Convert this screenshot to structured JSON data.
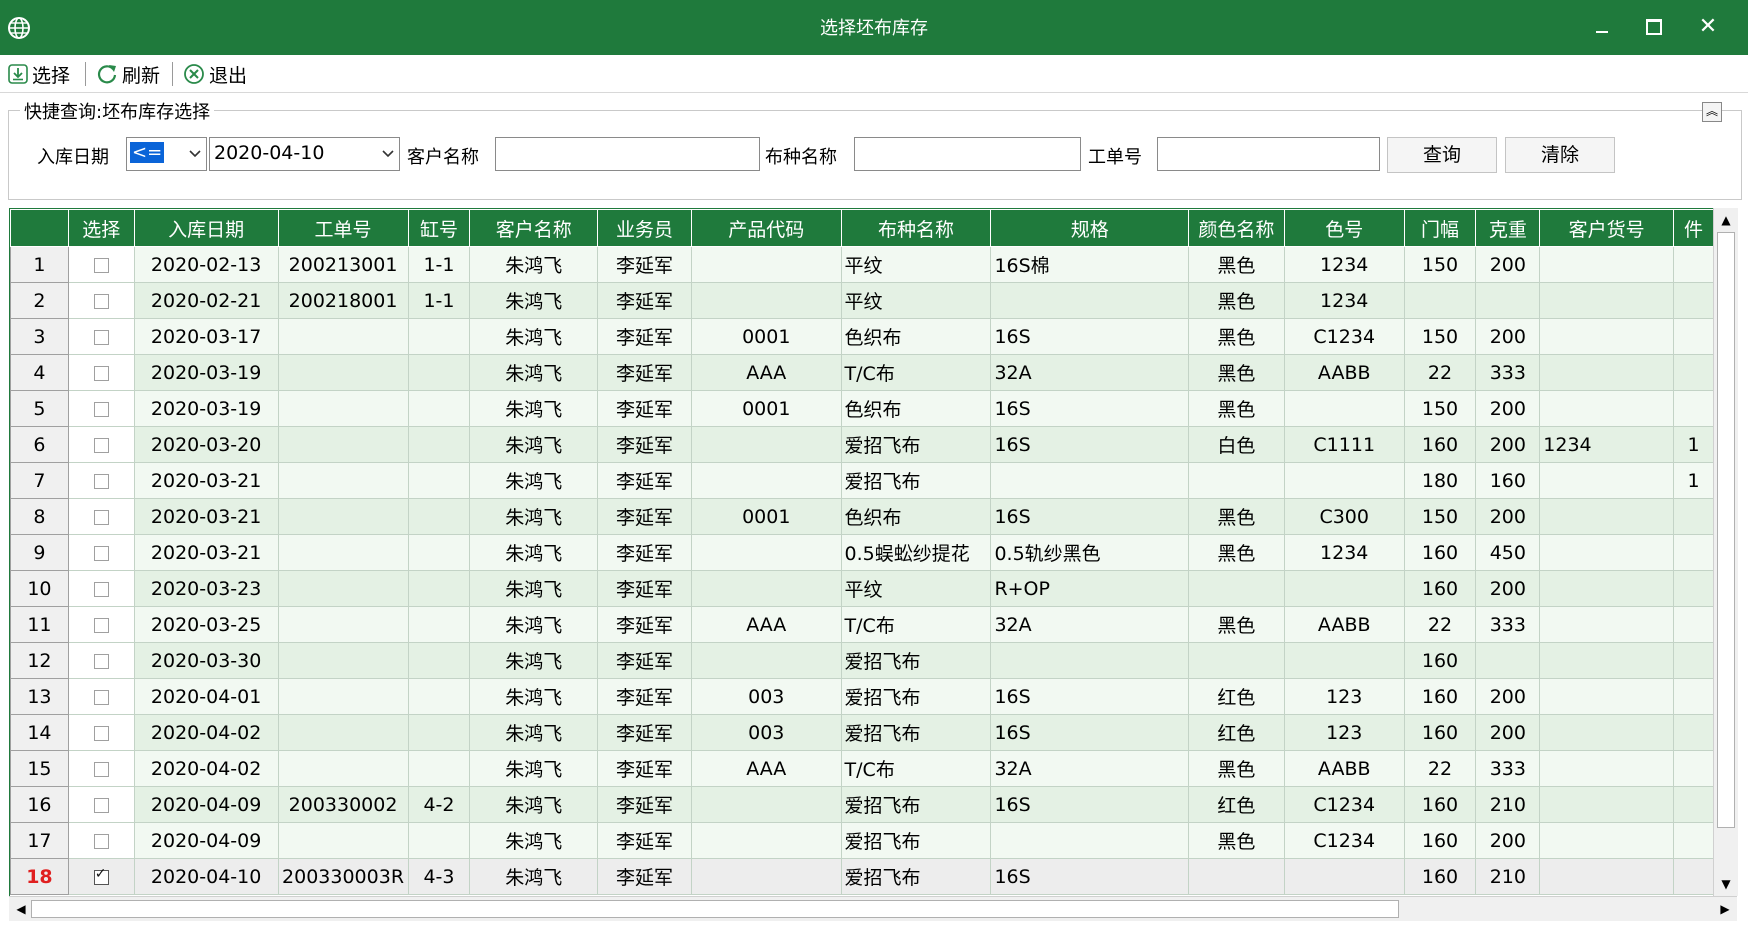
{
  "window": {
    "title": "选择坯布库存"
  },
  "toolbar": {
    "select_label": "选择",
    "refresh_label": "刷新",
    "exit_label": "退出"
  },
  "query": {
    "group_title": "快捷查询:坯布库存选择",
    "date_label": "入库日期",
    "operator_value": "<=",
    "date_value": "2020-04-10",
    "customer_label": "客户名称",
    "customer_value": "",
    "fabric_label": "布种名称",
    "fabric_value": "",
    "order_label": "工单号",
    "order_value": "",
    "search_button": "查询",
    "clear_button": "清除"
  },
  "grid": {
    "columns": [
      "",
      "选择",
      "入库日期",
      "工单号",
      "缸号",
      "客户名称",
      "业务员",
      "产品代码",
      "布种名称",
      "规格",
      "颜色名称",
      "色号",
      "门幅",
      "克重",
      "客户货号",
      "件"
    ],
    "current_row": 18,
    "rows": [
      {
        "n": "1",
        "checked": false,
        "date": "2020-02-13",
        "order": "200213001",
        "vat": "1-1",
        "customer": "朱鸿飞",
        "sales": "李延军",
        "code": "",
        "fabric": "平纹",
        "spec": "16S棉",
        "color": "黑色",
        "colorno": "1234",
        "width": "150",
        "weight": "200",
        "custno": "",
        "pcs": ""
      },
      {
        "n": "2",
        "checked": false,
        "date": "2020-02-21",
        "order": "200218001",
        "vat": "1-1",
        "customer": "朱鸿飞",
        "sales": "李延军",
        "code": "",
        "fabric": "平纹",
        "spec": "",
        "color": "黑色",
        "colorno": "1234",
        "width": "",
        "weight": "",
        "custno": "",
        "pcs": ""
      },
      {
        "n": "3",
        "checked": false,
        "date": "2020-03-17",
        "order": "",
        "vat": "",
        "customer": "朱鸿飞",
        "sales": "李延军",
        "code": "0001",
        "fabric": "色织布",
        "spec": "16S",
        "color": "黑色",
        "colorno": "C1234",
        "width": "150",
        "weight": "200",
        "custno": "",
        "pcs": ""
      },
      {
        "n": "4",
        "checked": false,
        "date": "2020-03-19",
        "order": "",
        "vat": "",
        "customer": "朱鸿飞",
        "sales": "李延军",
        "code": "AAA",
        "fabric": "T/C布",
        "spec": "32A",
        "color": "黑色",
        "colorno": "AABB",
        "width": "22",
        "weight": "333",
        "custno": "",
        "pcs": ""
      },
      {
        "n": "5",
        "checked": false,
        "date": "2020-03-19",
        "order": "",
        "vat": "",
        "customer": "朱鸿飞",
        "sales": "李延军",
        "code": "0001",
        "fabric": "色织布",
        "spec": "16S",
        "color": "黑色",
        "colorno": "",
        "width": "150",
        "weight": "200",
        "custno": "",
        "pcs": ""
      },
      {
        "n": "6",
        "checked": false,
        "date": "2020-03-20",
        "order": "",
        "vat": "",
        "customer": "朱鸿飞",
        "sales": "李延军",
        "code": "",
        "fabric": "爱招飞布",
        "spec": "16S",
        "color": "白色",
        "colorno": "C1111",
        "width": "160",
        "weight": "200",
        "custno": "1234",
        "pcs": "1"
      },
      {
        "n": "7",
        "checked": false,
        "date": "2020-03-21",
        "order": "",
        "vat": "",
        "customer": "朱鸿飞",
        "sales": "李延军",
        "code": "",
        "fabric": "爱招飞布",
        "spec": "",
        "color": "",
        "colorno": "",
        "width": "180",
        "weight": "160",
        "custno": "",
        "pcs": "1"
      },
      {
        "n": "8",
        "checked": false,
        "date": "2020-03-21",
        "order": "",
        "vat": "",
        "customer": "朱鸿飞",
        "sales": "李延军",
        "code": "0001",
        "fabric": "色织布",
        "spec": "16S",
        "color": "黑色",
        "colorno": "C300",
        "width": "150",
        "weight": "200",
        "custno": "",
        "pcs": ""
      },
      {
        "n": "9",
        "checked": false,
        "date": "2020-03-21",
        "order": "",
        "vat": "",
        "customer": "朱鸿飞",
        "sales": "李延军",
        "code": "",
        "fabric": "0.5蜈蚣纱提花",
        "spec": "0.5轨纱黑色",
        "color": "黑色",
        "colorno": "1234",
        "width": "160",
        "weight": "450",
        "custno": "",
        "pcs": ""
      },
      {
        "n": "10",
        "checked": false,
        "date": "2020-03-23",
        "order": "",
        "vat": "",
        "customer": "朱鸿飞",
        "sales": "李延军",
        "code": "",
        "fabric": "平纹",
        "spec": "R+OP",
        "color": "",
        "colorno": "",
        "width": "160",
        "weight": "200",
        "custno": "",
        "pcs": ""
      },
      {
        "n": "11",
        "checked": false,
        "date": "2020-03-25",
        "order": "",
        "vat": "",
        "customer": "朱鸿飞",
        "sales": "李延军",
        "code": "AAA",
        "fabric": "T/C布",
        "spec": "32A",
        "color": "黑色",
        "colorno": "AABB",
        "width": "22",
        "weight": "333",
        "custno": "",
        "pcs": ""
      },
      {
        "n": "12",
        "checked": false,
        "date": "2020-03-30",
        "order": "",
        "vat": "",
        "customer": "朱鸿飞",
        "sales": "李延军",
        "code": "",
        "fabric": "爱招飞布",
        "spec": "",
        "color": "",
        "colorno": "",
        "width": "160",
        "weight": "",
        "custno": "",
        "pcs": ""
      },
      {
        "n": "13",
        "checked": false,
        "date": "2020-04-01",
        "order": "",
        "vat": "",
        "customer": "朱鸿飞",
        "sales": "李延军",
        "code": "003",
        "fabric": "爱招飞布",
        "spec": "16S",
        "color": "红色",
        "colorno": "123",
        "width": "160",
        "weight": "200",
        "custno": "",
        "pcs": ""
      },
      {
        "n": "14",
        "checked": false,
        "date": "2020-04-02",
        "order": "",
        "vat": "",
        "customer": "朱鸿飞",
        "sales": "李延军",
        "code": "003",
        "fabric": "爱招飞布",
        "spec": "16S",
        "color": "红色",
        "colorno": "123",
        "width": "160",
        "weight": "200",
        "custno": "",
        "pcs": ""
      },
      {
        "n": "15",
        "checked": false,
        "date": "2020-04-02",
        "order": "",
        "vat": "",
        "customer": "朱鸿飞",
        "sales": "李延军",
        "code": "AAA",
        "fabric": "T/C布",
        "spec": "32A",
        "color": "黑色",
        "colorno": "AABB",
        "width": "22",
        "weight": "333",
        "custno": "",
        "pcs": ""
      },
      {
        "n": "16",
        "checked": false,
        "date": "2020-04-09",
        "order": "200330002",
        "vat": "4-2",
        "customer": "朱鸿飞",
        "sales": "李延军",
        "code": "",
        "fabric": "爱招飞布",
        "spec": "16S",
        "color": "红色",
        "colorno": "C1234",
        "width": "160",
        "weight": "210",
        "custno": "",
        "pcs": ""
      },
      {
        "n": "17",
        "checked": false,
        "date": "2020-04-09",
        "order": "",
        "vat": "",
        "customer": "朱鸿飞",
        "sales": "李延军",
        "code": "",
        "fabric": "爱招飞布",
        "spec": "",
        "color": "黑色",
        "colorno": "C1234",
        "width": "160",
        "weight": "200",
        "custno": "",
        "pcs": ""
      },
      {
        "n": "18",
        "checked": true,
        "date": "2020-04-10",
        "order": "200330003R",
        "vat": "4-3",
        "customer": "朱鸿飞",
        "sales": "李延军",
        "code": "",
        "fabric": "爱招飞布",
        "spec": "16S",
        "color": "",
        "colorno": "",
        "width": "160",
        "weight": "210",
        "custno": "",
        "pcs": ""
      }
    ]
  },
  "colors": {
    "accent": "#1f7a3c",
    "row_odd": "#f2f9f2",
    "row_even": "#e4f1e4",
    "current_row_number": "#e02020"
  },
  "icons": {
    "app": "globe-icon",
    "select": "download-icon",
    "refresh": "refresh-icon",
    "exit": "cancel-circle-icon"
  }
}
